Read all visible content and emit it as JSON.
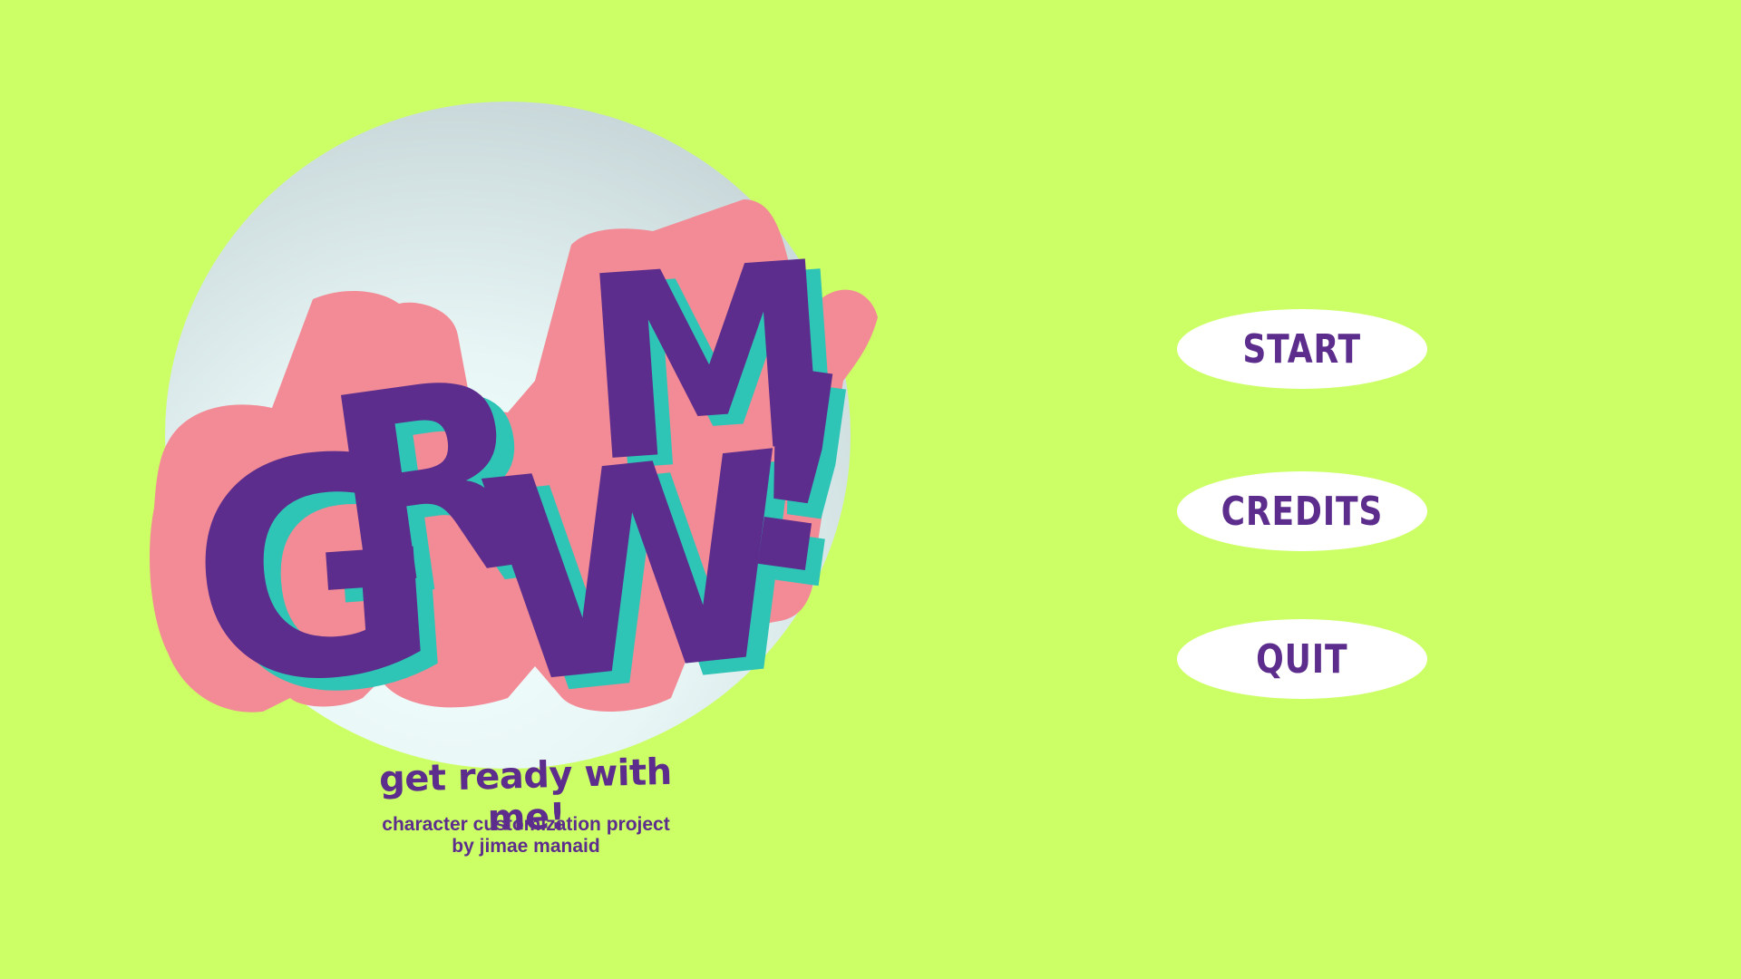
{
  "logo": {
    "text": "GRWM!",
    "letters": [
      "G",
      "R",
      "W",
      "M",
      "!"
    ],
    "fill_color": "#5c2d8c",
    "shadow_color": "#2ec4b6",
    "outline_color": "#f28b95",
    "backdrop_color": "#e8f6f6"
  },
  "tagline": "get ready with me!",
  "credit": {
    "line1": "character customization project",
    "line2": "by jimae manaid"
  },
  "menu": {
    "start_label": "START",
    "credits_label": "CREDITS",
    "quit_label": "QUIT"
  },
  "colors": {
    "background": "#ccff66",
    "accent": "#5c2d8c",
    "button": "#ffffff"
  }
}
